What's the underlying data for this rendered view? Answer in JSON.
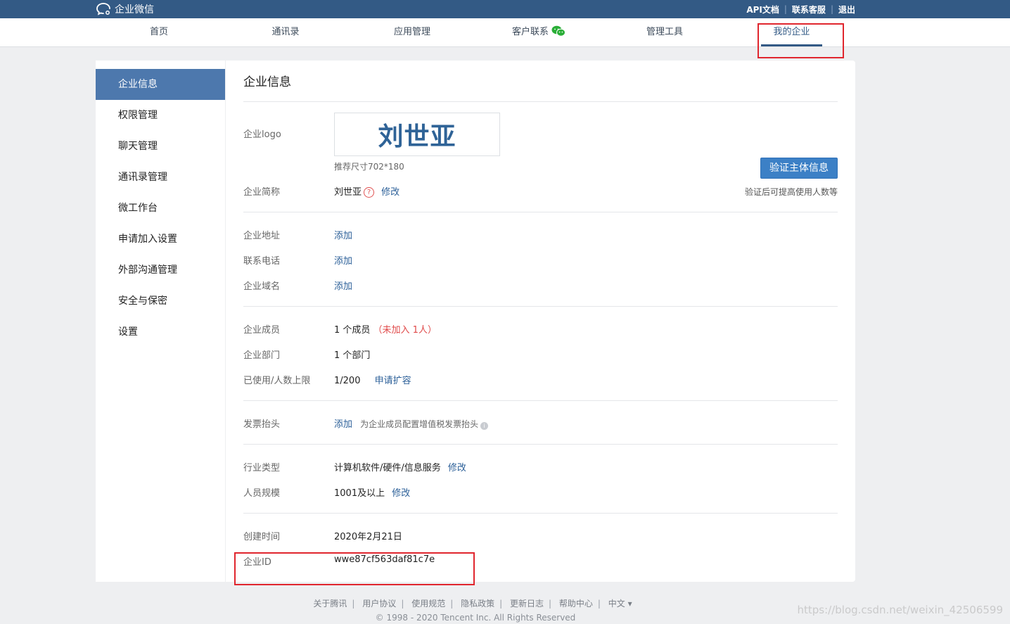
{
  "app": {
    "brand": "企业微信"
  },
  "top_links": [
    "API文档",
    "联系客服",
    "退出"
  ],
  "nav": [
    "首页",
    "通讯录",
    "应用管理",
    "客户联系",
    "管理工具",
    "我的企业"
  ],
  "sidebar": [
    "企业信息",
    "权限管理",
    "聊天管理",
    "通讯录管理",
    "微工作台",
    "申请加入设置",
    "外部沟通管理",
    "安全与保密",
    "设置"
  ],
  "main": {
    "title": "企业信息",
    "logo_label": "企业logo",
    "logo_text": "刘世亚",
    "logo_size_hint": "推荐尺寸702*180",
    "verify_button": "验证主体信息",
    "verify_hint": "验证后可提高使用人数等",
    "short_name_label": "企业简称",
    "short_name": "刘世亚",
    "help_q": "?",
    "modify": "修改",
    "address_label": "企业地址",
    "phone_label": "联系电话",
    "domain_label": "企业域名",
    "add": "添加",
    "members_label": "企业成员",
    "members_value": "1 个成员",
    "members_unjoined": "（未加入 1人）",
    "departments_label": "企业部门",
    "departments_value": "1 个部门",
    "limit_label": "已使用/人数上限",
    "limit_value": "1/200",
    "expand_link": "申请扩容",
    "invoice_label": "发票抬头",
    "invoice_hint": "为企业成员配置增值税发票抬头",
    "info_i": "i",
    "industry_label": "行业类型",
    "industry_value": "计算机软件/硬件/信息服务",
    "scale_label": "人员规模",
    "scale_value": "1001及以上",
    "created_label": "创建时间",
    "created_value": "2020年2月21日",
    "corp_id_label": "企业ID",
    "corp_id_value": "wwe87cf563daf81c7e"
  },
  "footer": {
    "links": [
      "关于腾讯",
      "用户协议",
      "使用规范",
      "隐私政策",
      "更新日志",
      "帮助中心",
      "中文 ▾"
    ],
    "copyright": "© 1998 - 2020 Tencent Inc. All Rights Reserved",
    "watermark": "https://blog.csdn.net/weixin_42506599"
  },
  "colors": {
    "topbar": "#335a85",
    "accent": "#4d78ad",
    "link": "#2b5f98",
    "highlight": "#e0262e",
    "warning": "#e04a4a"
  }
}
